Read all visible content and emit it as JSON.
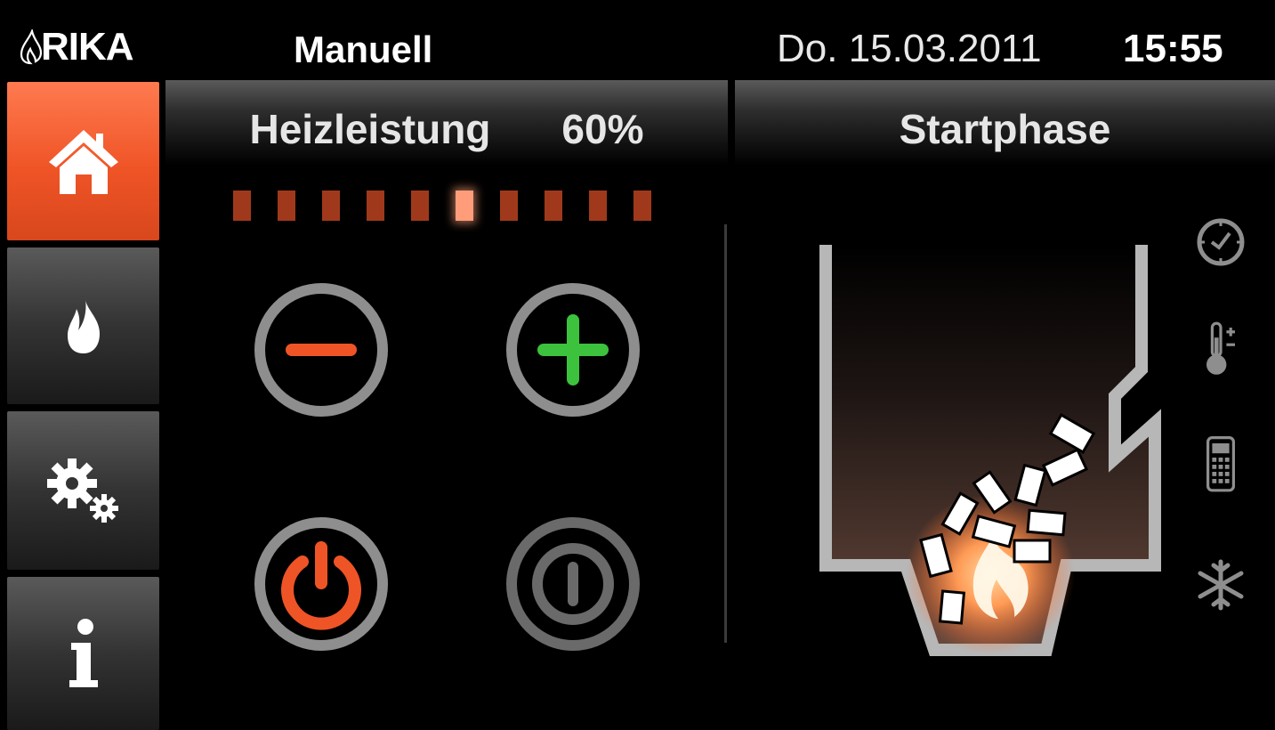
{
  "header": {
    "logo": "RIKA",
    "mode": "Manuell",
    "date": "Do. 15.03.2011",
    "time": "15:55"
  },
  "sidebar": {
    "items": [
      {
        "name": "home",
        "active": true
      },
      {
        "name": "flame",
        "active": false
      },
      {
        "name": "settings",
        "active": false
      },
      {
        "name": "info",
        "active": false
      }
    ]
  },
  "power": {
    "label": "Heizleistung",
    "value_text": "60%",
    "segments": 10,
    "active_segment": 6
  },
  "status": {
    "phase": "Startphase"
  },
  "controls": {
    "minus": "minus-icon",
    "plus": "plus-icon",
    "power_on": "power-icon",
    "power_off": "power-off-icon"
  },
  "side_icons": [
    "clock-icon",
    "thermometer-icon",
    "remote-icon",
    "snowflake-icon"
  ],
  "colors": {
    "accent": "#ef5426",
    "plus": "#3cc23c",
    "level_segment": "#a0391b",
    "level_active": "#ff9c7a"
  }
}
